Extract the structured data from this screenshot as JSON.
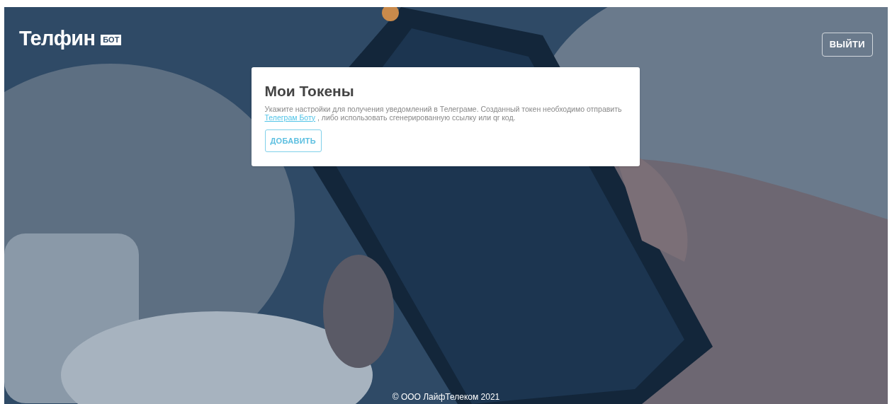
{
  "header": {
    "logo": {
      "name": "Телфин",
      "badge": "БОТ"
    },
    "logout_button": "ВЫЙТИ"
  },
  "card": {
    "title": "Мои Токены",
    "description_before": "Укажите настройки для получения уведомлений в Телеграме. Созданный токен необходимо отправить ",
    "link": "Телеграм Боту",
    "description_after": " , либо использовать сгенерированную ссылку или qr код.",
    "add_button": "ДОБАВИТЬ"
  },
  "footer": "© ООО ЛайфТелеком 2021"
}
